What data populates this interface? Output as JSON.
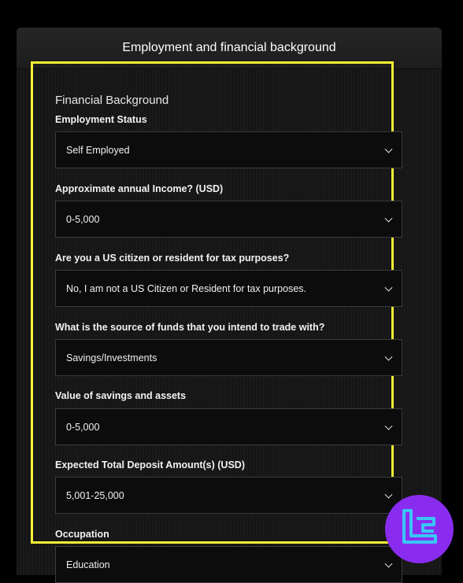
{
  "header": {
    "title": "Employment and financial background"
  },
  "form": {
    "section_title": "Financial Background",
    "fields": [
      {
        "label": "Employment Status",
        "value": "Self Employed"
      },
      {
        "label": "Approximate annual Income? (USD)",
        "value": "0-5,000"
      },
      {
        "label": "Are you a US citizen or resident for tax purposes?",
        "value": "No, I am not a US Citizen or Resident for tax purposes."
      },
      {
        "label": "What is the source of funds that you intend to trade with?",
        "value": "Savings/Investments"
      },
      {
        "label": "Value of savings and assets",
        "value": "0-5,000"
      },
      {
        "label": "Expected Total Deposit Amount(s) (USD)",
        "value": "5,001-25,000"
      },
      {
        "label": "Occupation",
        "value": "Education"
      }
    ]
  },
  "colors": {
    "highlight": "#f5f234",
    "logo_bg": "#8a2cf0",
    "logo_mark": "#39c6f4"
  },
  "icons": {
    "select": "chevron-down-icon",
    "logo": "tradingfinder-logo-icon"
  }
}
